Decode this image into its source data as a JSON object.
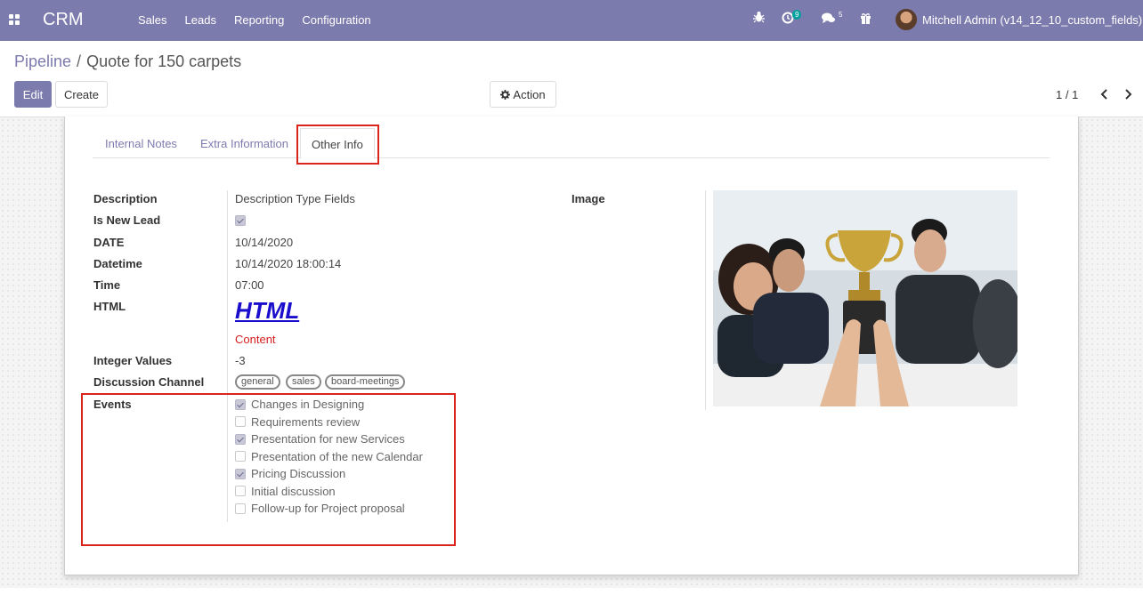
{
  "navbar": {
    "brand": "CRM",
    "menu": [
      "Sales",
      "Leads",
      "Reporting",
      "Configuration"
    ],
    "activity_count": "9",
    "message_count": "5",
    "user": "Mitchell Admin (v14_12_10_custom_fields)"
  },
  "breadcrumb": {
    "parent": "Pipeline",
    "separator": "/",
    "current": "Quote for 150 carpets"
  },
  "buttons": {
    "edit": "Edit",
    "create": "Create",
    "action": "Action"
  },
  "pager": "1 / 1",
  "tabs": [
    "Internal Notes",
    "Extra Information",
    "Other Info"
  ],
  "fields": {
    "description": {
      "label": "Description",
      "value": "Description Type Fields"
    },
    "is_new_lead": {
      "label": "Is New Lead",
      "checked": true
    },
    "date": {
      "label": "DATE",
      "value": "10/14/2020"
    },
    "datetime": {
      "label": "Datetime",
      "value": "10/14/2020 18:00:14"
    },
    "time": {
      "label": "Time",
      "value": "07:00"
    },
    "html": {
      "label": "HTML",
      "heading": "HTML",
      "content": "Content"
    },
    "integer": {
      "label": "Integer Values",
      "value": "-3"
    },
    "channel": {
      "label": "Discussion Channel",
      "tags": [
        "general",
        "sales",
        "board-meetings"
      ]
    },
    "events": {
      "label": "Events",
      "items": [
        {
          "name": "Changes in Designing",
          "checked": true
        },
        {
          "name": "Requirements review",
          "checked": false
        },
        {
          "name": "Presentation for new Services",
          "checked": true
        },
        {
          "name": "Presentation of the new Calendar",
          "checked": false
        },
        {
          "name": "Pricing Discussion",
          "checked": true
        },
        {
          "name": "Initial discussion",
          "checked": false
        },
        {
          "name": "Follow-up for Project proposal",
          "checked": false
        }
      ]
    },
    "image": {
      "label": "Image"
    }
  },
  "colors": {
    "brand": "#7c7bad",
    "highlight": "#d9251c",
    "html_link": "#1a0dcc"
  }
}
